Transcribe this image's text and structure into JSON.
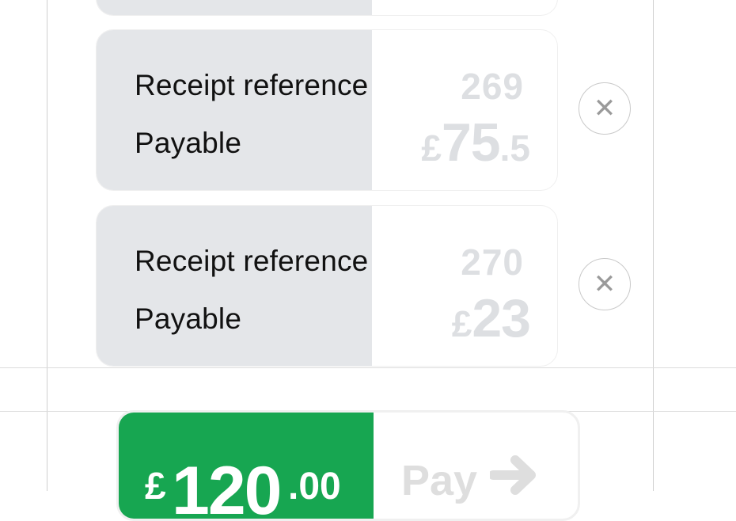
{
  "receipts": [
    {
      "reference_label": "Receipt reference",
      "reference_value": "269",
      "payable_label": "Payable",
      "payable_currency": "£",
      "payable_main": "75",
      "payable_decimal": ".5",
      "remove_icon": "close-icon"
    },
    {
      "reference_label": "Receipt reference",
      "reference_value": "270",
      "payable_label": "Payable",
      "payable_currency": "£",
      "payable_main": "23",
      "payable_decimal": "",
      "remove_icon": "close-icon"
    }
  ],
  "total": {
    "currency": "£",
    "main": "120",
    "decimal": ".00"
  },
  "pay_button": {
    "label": "Pay",
    "icon": "arrow-right-icon"
  },
  "colors": {
    "card_label_bg": "#e4e6e9",
    "muted_value": "#dddfe2",
    "total_green": "#17a651"
  }
}
